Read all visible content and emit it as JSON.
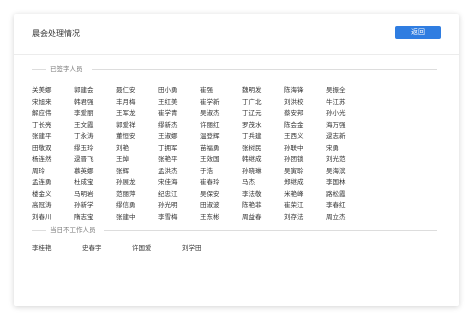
{
  "header": {
    "title": "晨会处理情况",
    "back_label": "返回"
  },
  "signed": {
    "label": "已签字人员",
    "names": [
      "关美娜",
      "郭建会",
      "聂仁安",
      "田小勇",
      "崔强",
      "魏明发",
      "陈海锋",
      "吴振全",
      "",
      "宋旭来",
      "韩君强",
      "丰月梅",
      "王红美",
      "崔学新",
      "丁广北",
      "刘洪校",
      "牛江苏",
      "",
      "解应伟",
      "李爱丽",
      "王军龙",
      "崔学青",
      "吴淑杰",
      "丁辽元",
      "蔡安邦",
      "孙小光",
      "",
      "丁长亮",
      "王文霞",
      "郭爱祥",
      "缪新杰",
      "许丽红",
      "罗茂水",
      "陈会金",
      "海万强",
      "",
      "张建平",
      "丁永涛",
      "董恒安",
      "王淑娜",
      "温登辉",
      "丁兵建",
      "王西义",
      "逯志新",
      "",
      "田敬双",
      "缪玉玲",
      "刘艳",
      "丁拥军",
      "苗福勇",
      "张树民",
      "孙联中",
      "宋勇",
      "",
      "杨连然",
      "逯晋飞",
      "王焯",
      "张艳平",
      "王效国",
      "韩继成",
      "孙团锁",
      "刘光范",
      "",
      "周玲",
      "慕英娜",
      "张辉",
      "孟洪杰",
      "于浩",
      "孙晓琳",
      "吴寅聆",
      "吴海滨",
      "",
      "孟连勇",
      "杜成宝",
      "孙展龙",
      "宋佳海",
      "崔春玲",
      "马杰",
      "郑继成",
      "李国林",
      "",
      "楼金义",
      "马明岩",
      "范丽萍",
      "纪忠江",
      "吴保安",
      "李法敬",
      "米艳峰",
      "路松霞",
      "",
      "高冠涛",
      "孙新学",
      "缪信勇",
      "孙光明",
      "田淑波",
      "陈艳菲",
      "崔荣江",
      "李春红",
      "",
      "刘春川",
      "隋志宝",
      "张建中",
      "李雪梅",
      "王东彬",
      "周益春",
      "刘存法",
      "周立杰",
      ""
    ]
  },
  "absent": {
    "label": "当日不工作人员",
    "names": [
      "李桂艳",
      "史春宇",
      "许国爱",
      "刘学田"
    ]
  },
  "colors": {
    "accent": "#2f7de1",
    "text": "#333333"
  }
}
